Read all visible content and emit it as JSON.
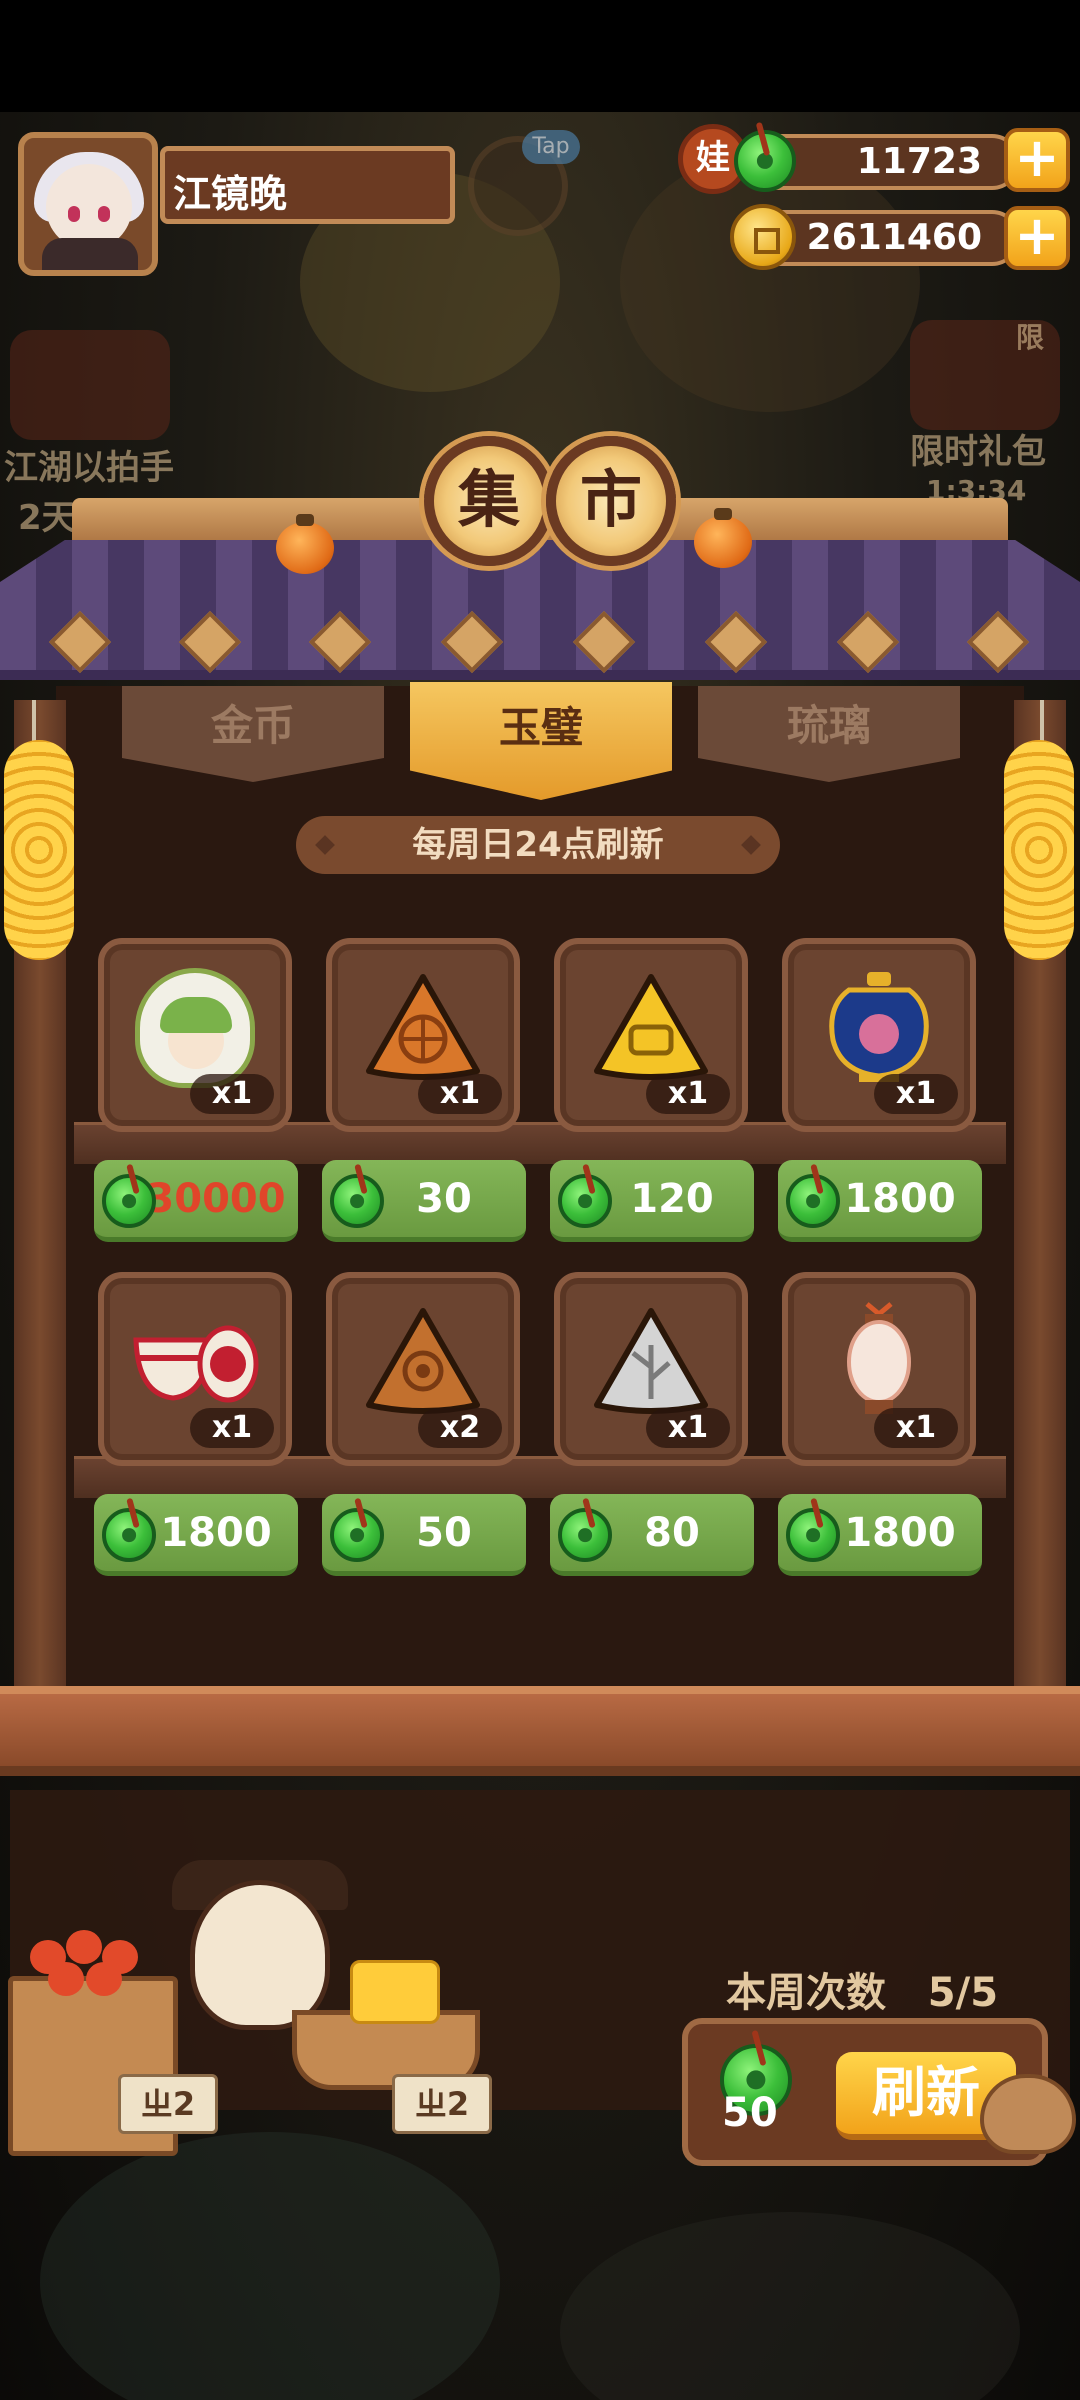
{
  "player": {
    "name": "江镜晚"
  },
  "tap_hint": "Tap",
  "currencies": {
    "jade_badge": "娃",
    "jade": "11723",
    "coins": "2611460",
    "add_symbol": "+"
  },
  "side_events": {
    "left_title": "江湖以拍手",
    "left_timer": "2天",
    "right_title": "限时礼包",
    "right_timer": "1:3:34",
    "right_badge": "限"
  },
  "market": {
    "sign": [
      "集",
      "市"
    ],
    "tabs": [
      {
        "label": "金币",
        "active": false
      },
      {
        "label": "玉璧",
        "active": true
      },
      {
        "label": "琉璃",
        "active": false
      }
    ],
    "refresh_note": "每周日24点刷新",
    "rows": [
      [
        {
          "icon": "doll-character-icon",
          "qty": "x1",
          "price": "30000",
          "price_color": "red"
        },
        {
          "icon": "orange-triangle-token-icon",
          "qty": "x1",
          "price": "30"
        },
        {
          "icon": "yellow-triangle-token-icon",
          "qty": "x1",
          "price": "120"
        },
        {
          "icon": "blue-porcelain-jar-icon",
          "qty": "x1",
          "price": "1800"
        }
      ],
      [
        {
          "icon": "porcelain-bowl-set-icon",
          "qty": "x1",
          "price": "1800"
        },
        {
          "icon": "brown-triangle-token-icon",
          "qty": "x2",
          "price": "50"
        },
        {
          "icon": "white-triangle-token-icon",
          "qty": "x1",
          "price": "80"
        },
        {
          "icon": "paper-lantern-icon",
          "qty": "x1",
          "price": "1800"
        }
      ]
    ]
  },
  "refresh": {
    "week_label": "本周次数",
    "count": "5/5",
    "cost": "50",
    "button": "刷新"
  },
  "stall": {
    "price_tags": [
      "ㄓ2",
      "ㄓ2"
    ]
  },
  "colors": {
    "price_green": "#78a94c",
    "accent_gold": "#f5c250",
    "wood_dark": "#2a1810",
    "red_price": "#e0452a"
  }
}
